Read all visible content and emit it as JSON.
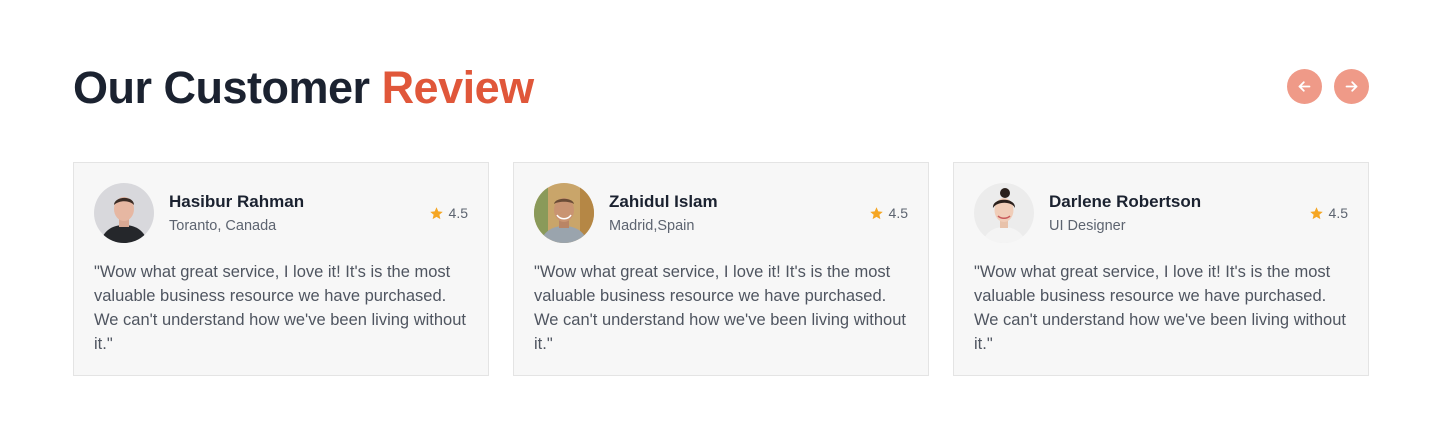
{
  "section": {
    "title_main": "Our Customer",
    "title_accent": "Review"
  },
  "colors": {
    "accent": "#e0573a",
    "nav_button": "#ef9a88",
    "star": "#f5a623",
    "card_bg": "#f7f7f7"
  },
  "nav": {
    "prev_icon": "arrow-left-icon",
    "next_icon": "arrow-right-icon"
  },
  "reviews": [
    {
      "name": "Hasibur Rahman",
      "location": "Toranto, Canada",
      "rating": "4.5",
      "text": "\"Wow what great service, I love it! It's is the most valuable business resource we have purchased. We can't understand how we've been living without it.\""
    },
    {
      "name": "Zahidul Islam",
      "location": "Madrid,Spain",
      "rating": "4.5",
      "text": "\"Wow what great service, I love it! It's is the most valuable business resource we have purchased. We can't understand how we've been living without it.\""
    },
    {
      "name": "Darlene Robertson",
      "location": "UI Designer",
      "rating": "4.5",
      "text": "\"Wow what great service, I love it! It's is the most valuable business resource we have purchased. We can't understand how we've been living without it.\""
    }
  ]
}
